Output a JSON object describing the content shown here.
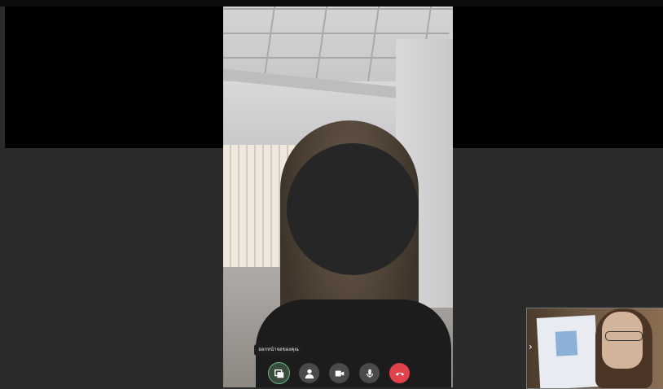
{
  "call": {
    "controls_tooltip": "ออกหน้าจอของคุณ",
    "controls": [
      {
        "name": "screen-share-button",
        "icon": "screen-share-icon"
      },
      {
        "name": "add-person-button",
        "icon": "person-add-icon"
      },
      {
        "name": "camera-button",
        "icon": "video-camera-icon"
      },
      {
        "name": "microphone-button",
        "icon": "microphone-icon"
      },
      {
        "name": "hang-up-button",
        "icon": "phone-hangup-icon"
      }
    ]
  },
  "self_view": {
    "chevron_icon": "chevron-right-icon",
    "chevron_glyph": "›"
  },
  "colors": {
    "hangup": "#e0424b",
    "control_bg": "#4a4a4a",
    "backdrop": "#2b2b2b"
  }
}
